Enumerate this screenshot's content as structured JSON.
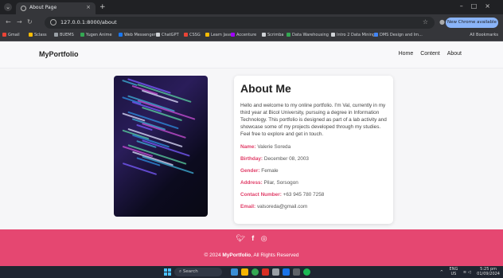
{
  "browser": {
    "tab_title": "About Page",
    "tab_close": "×",
    "new_tab": "+",
    "window_controls": "–□×",
    "url": "127.0.0.1:8000/about",
    "update_label": "New Chrome available",
    "bookmarks": [
      {
        "label": "Gmail",
        "color": "#ea4335"
      },
      {
        "label": "Sclass",
        "color": "#fbbc04"
      },
      {
        "label": "BUEMS",
        "color": "#9aa0a6"
      },
      {
        "label": "Yugen Anime",
        "color": "#34a853"
      },
      {
        "label": "Web Messenger",
        "color": "#1877f2"
      },
      {
        "label": "ChatGPT",
        "color": "#cfd2d6"
      },
      {
        "label": "CSSG",
        "color": "#ea4335"
      },
      {
        "label": "Learn Java",
        "color": "#fbbc04"
      },
      {
        "label": "Accenture",
        "color": "#a100ff"
      },
      {
        "label": "Scrimba",
        "color": "#cfd2d6"
      },
      {
        "label": "Data Warehousing",
        "color": "#34a853"
      },
      {
        "label": "Intro 2 Data Mining",
        "color": "#cfd2d6"
      },
      {
        "label": "DMS Design and Im...",
        "color": "#4285f4"
      }
    ],
    "all_bookmarks": "All Bookmarks"
  },
  "site": {
    "brand": "MyPortfolio",
    "nav": [
      "Home",
      "Content",
      "About"
    ]
  },
  "about": {
    "heading": "About Me",
    "intro": "Hello and welcome to my online portfolio. I'm Val, currently in my third year at Bicol University, pursuing a degree in Information Technology. This portfolio is designed as part of a lab activity and showcase some of my projects developed through my studies. Feel free to explore and get in touch.",
    "fields": [
      {
        "key": "Name:",
        "value": "Valerie Soreda"
      },
      {
        "key": "Birthday:",
        "value": "December 08, 2003"
      },
      {
        "key": "Gender:",
        "value": "Female"
      },
      {
        "key": "Address:",
        "value": "Pilar, Sorsogon"
      },
      {
        "key": "Contact Number:",
        "value": "+63 945 780 7258"
      },
      {
        "key": "Email:",
        "value": "valsoreda@gmail.com"
      }
    ]
  },
  "footer": {
    "social_icons": [
      "twitter-icon",
      "facebook-icon",
      "instagram-icon"
    ],
    "copyright_prefix": "© 2024 ",
    "copyright_brand": "MyPortfolio",
    "copyright_suffix": ", All Rights Reserved",
    "color": "#e54771"
  },
  "taskbar": {
    "search_placeholder": "Search",
    "lang": "ENG",
    "region": "US",
    "time": "5:25 pm",
    "date": "01/09/2024"
  }
}
